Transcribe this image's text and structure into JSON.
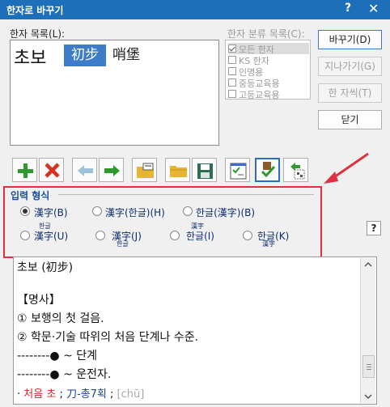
{
  "window": {
    "title": "한자로 바꾸기",
    "help_label": "?",
    "close_label": "✕"
  },
  "hanja_list": {
    "label": "한자 목록(L):",
    "hangul": "초보",
    "options": [
      "初步",
      "哨堡"
    ],
    "selected_index": 0
  },
  "category_list": {
    "label": "한자 분류 목록(C):",
    "items": [
      {
        "label": "모든 한자",
        "checked": true
      },
      {
        "label": "KS 한자",
        "checked": false
      },
      {
        "label": "인명용",
        "checked": false
      },
      {
        "label": "중등교육용",
        "checked": false
      },
      {
        "label": "고등교육용",
        "checked": false
      }
    ]
  },
  "buttons": {
    "convert": "바꾸기(D)",
    "skip": "지나가기(G)",
    "single_char": "한 자씩(T)",
    "close": "닫기"
  },
  "toolbar": {
    "items": [
      "add-icon",
      "delete-icon",
      "arrow-left-icon",
      "arrow-right-icon",
      "open-dictionary-icon",
      "folder-icon",
      "save-icon",
      "checklist-icon",
      "apply-check-icon",
      "undo-grid-icon"
    ]
  },
  "input_format": {
    "label": "입력 형식",
    "row1": [
      {
        "label": "漢字(B)",
        "selected": true
      },
      {
        "label": "漢字(한글)(H)",
        "selected": false
      },
      {
        "label": "한글(漢字)(B)",
        "selected": false
      }
    ],
    "row2": [
      {
        "main": "漢字(U)",
        "ruby_top": "한글",
        "ruby_bottom": ""
      },
      {
        "main": "漢字(J)",
        "ruby_top": "",
        "ruby_bottom": "한글"
      },
      {
        "main": "한글(I)",
        "ruby_top": "漢字",
        "ruby_bottom": ""
      },
      {
        "main": "한글(K)",
        "ruby_top": "",
        "ruby_bottom": "漢字"
      }
    ]
  },
  "help_button": "?",
  "content": {
    "lines": [
      "초보 (初步)",
      "",
      "【명사】",
      "① 보행의 첫 걸음.",
      "② 학문·기술 따위의 처음 단계나 수준.",
      "--------● ~ 단계",
      "--------● ~ 운전자."
    ],
    "last_line": {
      "prefix": "·",
      "red": "처음 초",
      "sep": ";",
      "blue": "刀-총7획",
      "sep2": ";",
      "gray": "[chū]"
    }
  },
  "colors": {
    "title_bar": "#1c6fb8",
    "highlight": "#3d7cc9",
    "annotation": "#e0303f"
  }
}
